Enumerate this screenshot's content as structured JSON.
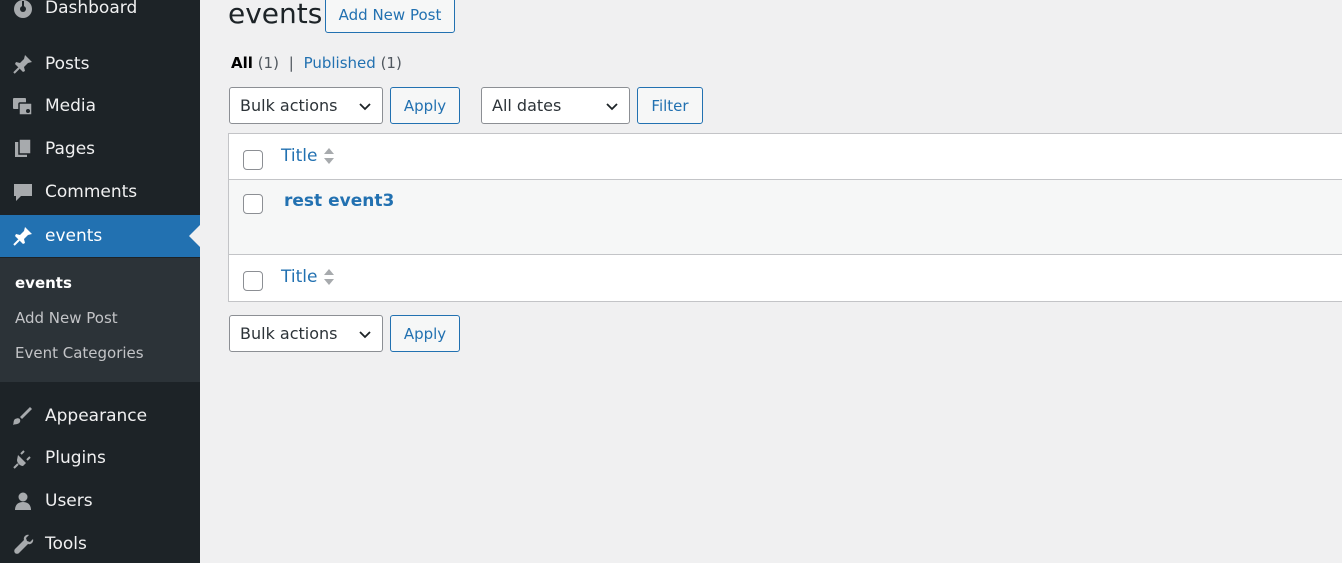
{
  "sidebar": {
    "items": [
      {
        "label": "Dashboard",
        "icon": "dashboard-icon"
      },
      {
        "label": "Posts",
        "icon": "pin-icon"
      },
      {
        "label": "Media",
        "icon": "media-icon"
      },
      {
        "label": "Pages",
        "icon": "pages-icon"
      },
      {
        "label": "Comments",
        "icon": "comment-icon"
      },
      {
        "label": "events",
        "icon": "pin-icon"
      },
      {
        "label": "Appearance",
        "icon": "brush-icon"
      },
      {
        "label": "Plugins",
        "icon": "plugin-icon"
      },
      {
        "label": "Users",
        "icon": "user-icon"
      },
      {
        "label": "Tools",
        "icon": "wrench-icon"
      }
    ],
    "submenu": [
      {
        "label": "events"
      },
      {
        "label": "Add New Post"
      },
      {
        "label": "Event Categories"
      }
    ]
  },
  "main": {
    "title": "events",
    "add_new_label": "Add New Post",
    "views": {
      "all_label": "All",
      "all_count": "(1)",
      "separator": "|",
      "published_label": "Published",
      "published_count": "(1)"
    },
    "bulk_actions": {
      "selected": "Bulk actions",
      "apply_label": "Apply"
    },
    "dates_filter": {
      "selected": "All dates",
      "filter_label": "Filter"
    },
    "table": {
      "column_title": "Title",
      "rows": [
        {
          "title": "rest event3"
        }
      ]
    },
    "bulk_actions_bottom": {
      "selected": "Bulk actions",
      "apply_label": "Apply"
    }
  },
  "colors": {
    "sidebar_bg": "#1d2327",
    "submenu_bg": "#2c3338",
    "accent": "#2271b1",
    "page_bg": "#f0f0f1"
  }
}
